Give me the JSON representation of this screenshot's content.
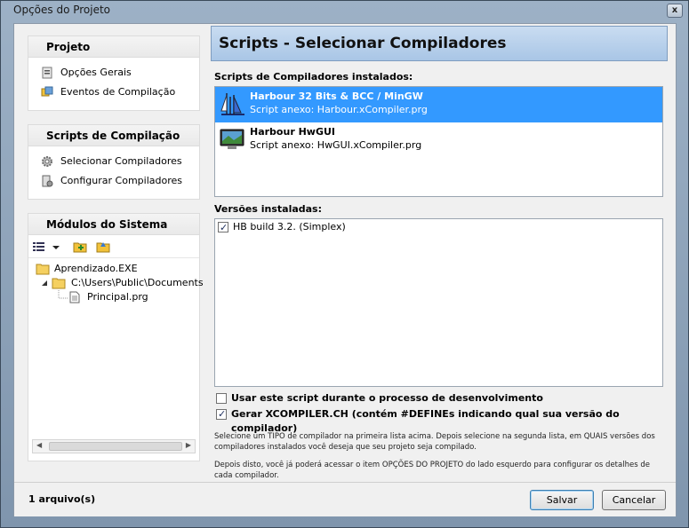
{
  "window": {
    "title": "Opções do Projeto",
    "close_label": "x"
  },
  "left": {
    "projeto": {
      "header": "Projeto",
      "items": [
        {
          "label": "Opções Gerais",
          "icon": "settings-icon"
        },
        {
          "label": "Eventos de Compilação",
          "icon": "events-icon"
        }
      ]
    },
    "scripts": {
      "header": "Scripts de Compilação",
      "items": [
        {
          "label": "Selecionar Compiladores",
          "icon": "gear-icon"
        },
        {
          "label": "Configurar Compiladores",
          "icon": "configure-icon"
        }
      ]
    },
    "modulos": {
      "header": "Módulos do Sistema",
      "tree": [
        {
          "label": "Aprendizado.EXE"
        },
        {
          "label": "C:\\Users\\Public\\Documents"
        },
        {
          "label": "Principal.prg"
        }
      ]
    }
  },
  "main": {
    "header": "Scripts - Selecionar Compiladores",
    "installed_label": "Scripts de Compiladores instalados:",
    "compilers": [
      {
        "name": "Harbour 32 Bits & BCC / MinGW",
        "script": "Script anexo: Harbour.xCompiler.prg",
        "selected": true
      },
      {
        "name": "Harbour HwGUI",
        "script": "Script anexo: HwGUI.xCompiler.prg",
        "selected": false
      }
    ],
    "versions_label": "Versões instaladas:",
    "versions": [
      {
        "label": "HB build 3.2. (Simplex)",
        "checked": true
      }
    ],
    "option_dev": {
      "label": "Usar este script durante o processo de desenvolvimento",
      "checked": false
    },
    "option_gen": {
      "label": "Gerar XCOMPILER.CH (contém #DEFINEs indicando qual sua versão do compilador)",
      "checked": true
    },
    "help1": "Selecione um TIPO de compilador na primeira lista acima. Depois selecione na segunda lista, em QUAIS versões dos compiladores instalados você deseja que seu projeto seja compilado.",
    "help2": "Depois disto, você já poderá acessar o item OPÇÕES DO PROJETO do lado esquerdo para configurar os detalhes de cada compilador."
  },
  "footer": {
    "files": "1 arquivo(s)",
    "save": "Salvar",
    "cancel": "Cancelar"
  }
}
